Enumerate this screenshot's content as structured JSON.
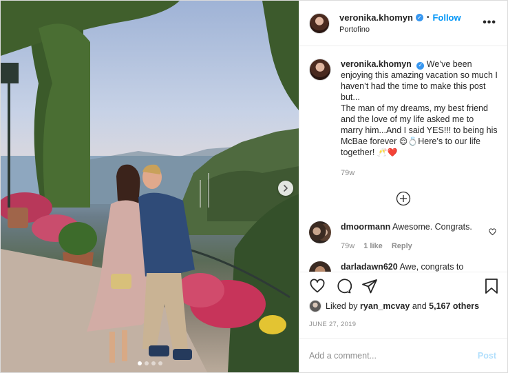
{
  "post": {
    "username": "veronika.khomyn",
    "verified": true,
    "follow_label": "Follow",
    "separator": "•",
    "location": "Portofino",
    "more_label": "•••",
    "image_count": 4,
    "active_image_index": 0
  },
  "caption": {
    "username": "veronika.khomyn",
    "text_1": "We’ve been enjoying this amazing vacation so much I haven’t had the time to make this post but...",
    "text_2": "The man of my dreams, my best friend and the love of my life asked me to marry him...And I said YES!!! to being his McBae forever",
    "emoji_1": "😌💍",
    "text_3": "Here’s to our life together!",
    "emoji_2": "🥂❤️",
    "time": "79w"
  },
  "comments": [
    {
      "username": "dmoormann",
      "text": "Awesome. Congrats.",
      "time": "79w",
      "likes": "1 like",
      "reply": "Reply"
    },
    {
      "username": "darladawn620",
      "text": "Awe, congrats to",
      "time": "",
      "likes": "",
      "reply": ""
    }
  ],
  "likes": {
    "prefix": "Liked by",
    "user": "ryan_mcvay",
    "conjunction": "and",
    "others": "5,167 others"
  },
  "date": "JUNE 27, 2019",
  "add_comment": {
    "placeholder": "Add a comment...",
    "post_label": "Post"
  },
  "colors": {
    "accent": "#0095f6",
    "verified": "#3897f0",
    "post_disabled": "#b2dffc",
    "muted": "#8e8e8e"
  },
  "icons": {
    "like": "heart-icon",
    "comment": "comment-icon",
    "share": "paper-plane-icon",
    "save": "bookmark-icon",
    "next": "chevron-right-icon",
    "load_more": "plus-circle-icon"
  }
}
